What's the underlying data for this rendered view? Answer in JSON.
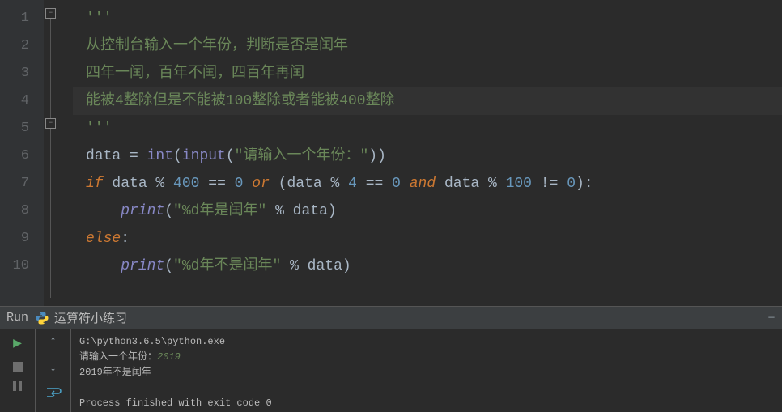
{
  "editor": {
    "line_numbers": [
      "1",
      "2",
      "3",
      "4",
      "5",
      "6",
      "7",
      "8",
      "9",
      "10"
    ],
    "c1_quote": "'''",
    "c2": "从控制台输入一个年份，判断是否是闰年",
    "c3": "四年一闰，百年不闰，四百年再闰",
    "c4": "能被4整除但是不能被100整除或者能被400整除",
    "c5_quote": "'''",
    "l6_data": "data ",
    "l6_eq": "= ",
    "l6_int": "int",
    "l6_p1": "(",
    "l6_input": "input",
    "l6_p2": "(",
    "l6_str": "\"请输入一个年份：\"",
    "l6_p3": "))",
    "l7_if": "if",
    "l7_sp1": " ",
    "l7_e1": "data % ",
    "l7_400": "400 ",
    "l7_eq1": "== ",
    "l7_0a": "0 ",
    "l7_or": "or",
    "l7_sp2": " (data % ",
    "l7_4": "4 ",
    "l7_eq2": "== ",
    "l7_0b": "0 ",
    "l7_and": "and",
    "l7_sp3": " data % ",
    "l7_100": "100 ",
    "l7_ne": "!= ",
    "l7_0c": "0",
    "l7_end": "):",
    "l8_ind": "    ",
    "l8_print": "print",
    "l8_p1": "(",
    "l8_str": "\"%d年是闰年\" ",
    "l8_pct": "% data)",
    "l9_else": "else",
    "l9_colon": ":",
    "l10_ind": "    ",
    "l10_print": "print",
    "l10_p1": "(",
    "l10_str": "\"%d年不是闰年\" ",
    "l10_pct": "% data)"
  },
  "runbar": {
    "label": "Run",
    "config": "运算符小练习"
  },
  "console": {
    "exe": "G:\\python3.6.5\\python.exe",
    "prompt": "请输入一个年份：",
    "input": "2019",
    "out": "2019年不是闰年",
    "exit": "Process finished with exit code 0"
  }
}
